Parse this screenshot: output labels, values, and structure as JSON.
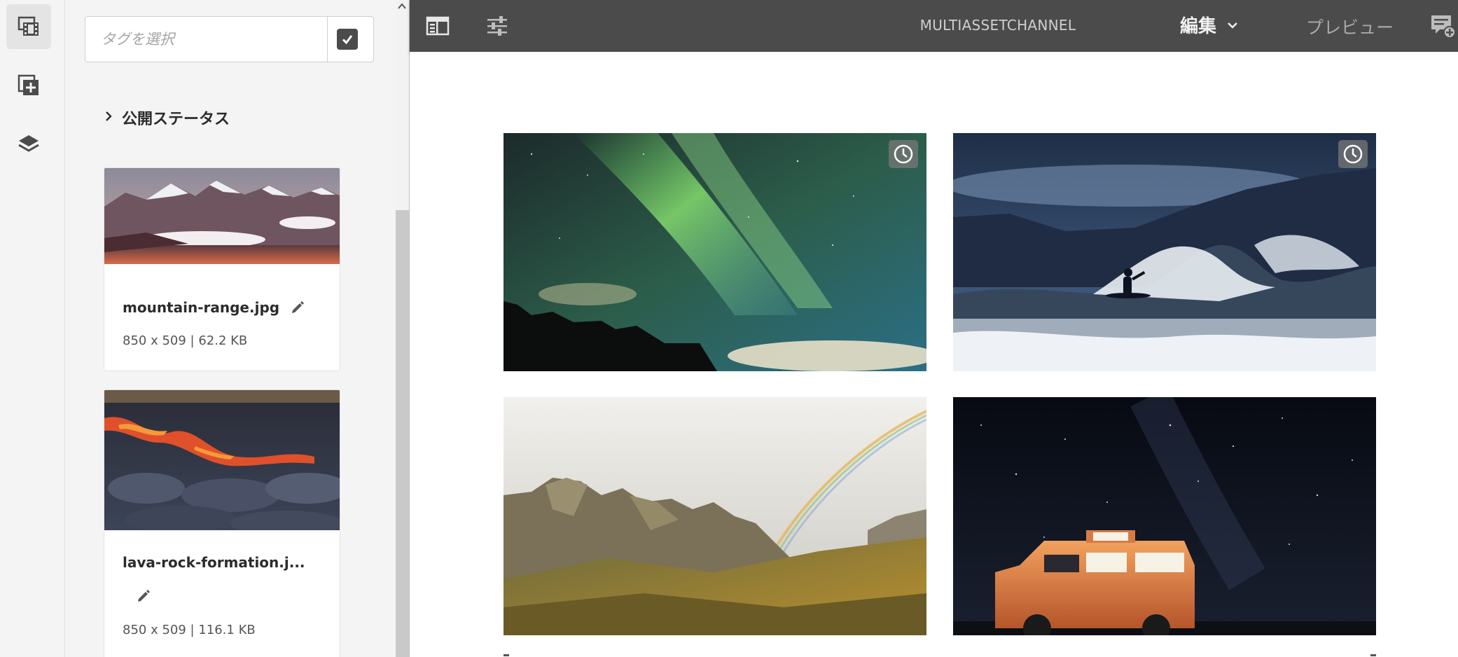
{
  "sidebar": {
    "rail": {
      "items": [
        {
          "icon": "asset-filmstrip-icon",
          "active": true
        },
        {
          "icon": "add-component-icon",
          "active": false
        },
        {
          "icon": "layers-icon",
          "active": false
        }
      ]
    },
    "tag_picker": {
      "placeholder": "タグを選択",
      "checkbox_checked": true
    },
    "status_filter": {
      "label": "公開ステータス"
    },
    "assets": [
      {
        "name": "mountain-range.jpg",
        "meta": "850 x 509 | 62.2 KB"
      },
      {
        "name": "lava-rock-formation.j...",
        "meta": "850 x 509 | 116.1 KB"
      }
    ]
  },
  "topbar": {
    "title": "MULTIASSETCHANNEL",
    "mode": "編集",
    "preview": "プレビュー",
    "icons": [
      "side-panel-toggle-icon",
      "properties-sliders-icon",
      "annotate-icon"
    ]
  },
  "canvas": {
    "tiles": [
      {
        "name": "aurora-image",
        "scheduled": true
      },
      {
        "name": "surfer-image",
        "scheduled": true
      },
      {
        "name": "rainbow-mountains-image",
        "scheduled": false
      },
      {
        "name": "van-night-sky-image",
        "scheduled": false
      }
    ]
  },
  "colors": {
    "topbar_bg": "#4b4b4b",
    "panel_bg": "#f4f4f4",
    "accent_dark": "#4b4b4b"
  }
}
